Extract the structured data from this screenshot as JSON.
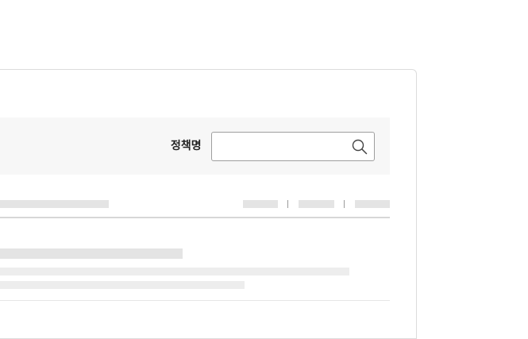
{
  "search": {
    "label": "정책명",
    "value": ""
  },
  "icons": {
    "search": "search-icon"
  },
  "colors": {
    "panel_background": "#f7f7f7",
    "skeleton": "#e4e4e4",
    "border": "#dcdcdc"
  }
}
